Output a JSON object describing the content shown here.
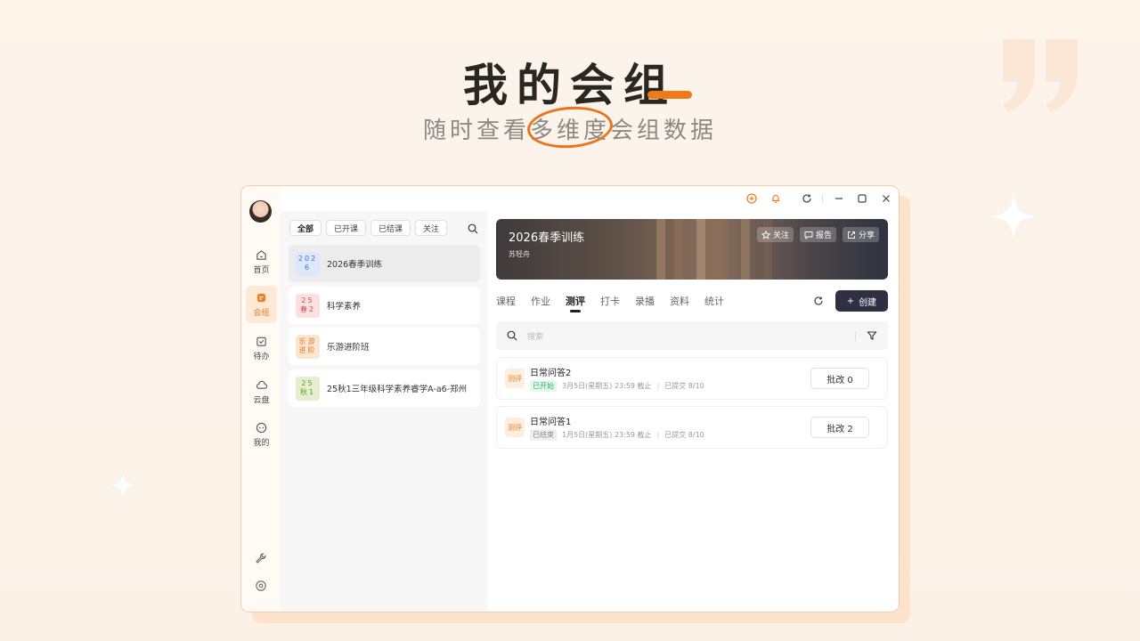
{
  "hero": {
    "title": "我的会组",
    "subtitle": "随时查看多维度会组数据"
  },
  "window": {
    "titlebar_icons": [
      "add-circle-icon",
      "bell-icon",
      "refresh-icon",
      "minimize-icon",
      "maximize-icon",
      "close-icon"
    ]
  },
  "rail": {
    "items": [
      {
        "label": "首页",
        "icon": "home-icon",
        "active": false
      },
      {
        "label": "会组",
        "icon": "group-icon",
        "active": true
      },
      {
        "label": "待办",
        "icon": "todo-icon",
        "active": false
      },
      {
        "label": "云盘",
        "icon": "cloud-icon",
        "active": false
      },
      {
        "label": "我的",
        "icon": "profile-icon",
        "active": false
      }
    ],
    "bottom_icons": [
      "wrench-icon",
      "settings-icon"
    ]
  },
  "group_list": {
    "filters": [
      {
        "label": "全部",
        "active": true
      },
      {
        "label": "已开课",
        "active": false
      },
      {
        "label": "已结课",
        "active": false
      },
      {
        "label": "关注",
        "active": false
      }
    ],
    "groups": [
      {
        "badge": "2026",
        "name": "2026春季训练",
        "selected": true,
        "badge_bg": "#dde9fb",
        "badge_fg": "#3d74d6"
      },
      {
        "badge": "25春2",
        "name": "科学素养",
        "selected": false,
        "badge_bg": "#fde0e0",
        "badge_fg": "#d24b4b"
      },
      {
        "badge": "乐游进阶",
        "name": "乐游进阶班",
        "selected": false,
        "badge_bg": "#fde6cf",
        "badge_fg": "#df7b26"
      },
      {
        "badge": "25秋1",
        "name": "25秋1三年级科学素养睿学A-a6-郑州",
        "selected": false,
        "badge_bg": "#e3efcf",
        "badge_fg": "#6a9a2f"
      }
    ]
  },
  "main": {
    "banner": {
      "title": "2026春季训练",
      "subtitle": "苏轻舟",
      "buttons": [
        {
          "label": "关注",
          "icon": "star-icon"
        },
        {
          "label": "报告",
          "icon": "report-icon"
        },
        {
          "label": "分享",
          "icon": "share-icon"
        }
      ]
    },
    "tabs": [
      {
        "label": "课程",
        "active": false
      },
      {
        "label": "作业",
        "active": false
      },
      {
        "label": "测评",
        "active": true
      },
      {
        "label": "打卡",
        "active": false
      },
      {
        "label": "录播",
        "active": false
      },
      {
        "label": "资料",
        "active": false
      },
      {
        "label": "统计",
        "active": false
      }
    ],
    "create_label": "创建",
    "search_placeholder": "搜索",
    "evaluations": [
      {
        "tag": "测评",
        "title": "日常问答2",
        "status": "已开始",
        "status_type": "started",
        "deadline": "3月5日(星期五) 23:59 截止",
        "submitted": "已提交 8/10",
        "review_label": "批改 0"
      },
      {
        "tag": "测评",
        "title": "日常问答1",
        "status": "已结束",
        "status_type": "ended",
        "deadline": "1月5日(星期五) 23:59 截止",
        "submitted": "已提交 8/10",
        "review_label": "批改 2"
      }
    ]
  }
}
